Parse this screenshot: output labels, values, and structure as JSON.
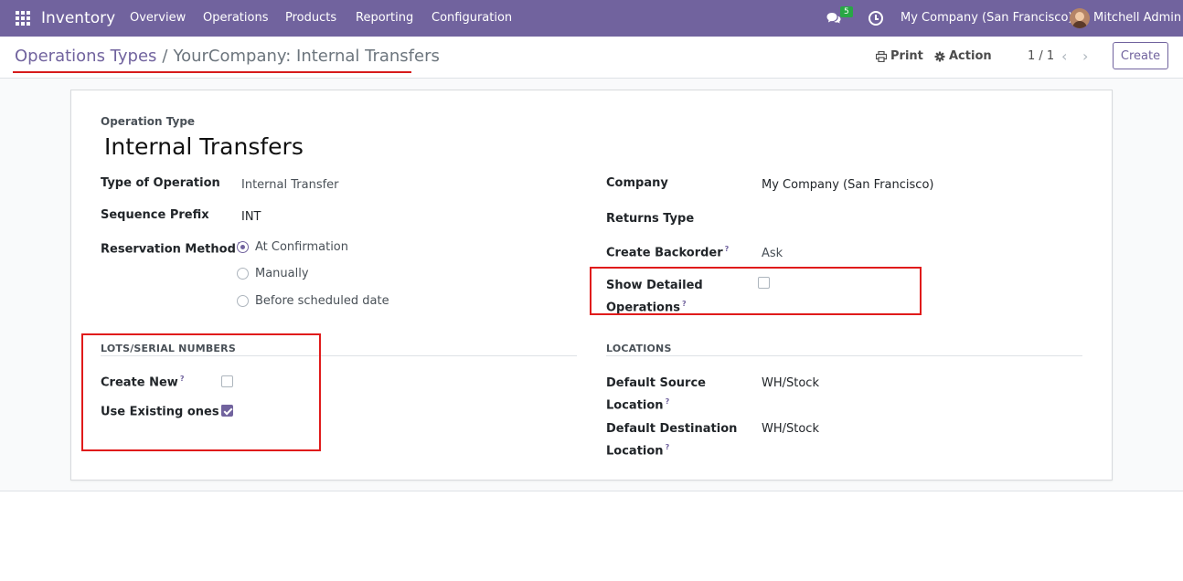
{
  "navbar": {
    "brand": "Inventory",
    "menu": [
      "Overview",
      "Operations",
      "Products",
      "Reporting",
      "Configuration"
    ],
    "chat_count": "5",
    "company": "My Company (San Francisco)",
    "user": "Mitchell Admin"
  },
  "control_panel": {
    "breadcrumb_parent": "Operations Types",
    "breadcrumb_separator": "/",
    "breadcrumb_current": "YourCompany: Internal Transfers",
    "print_label": "Print",
    "action_label": "Action",
    "pager": "1 / 1",
    "create_label": "Create"
  },
  "form": {
    "operation_type_label": "Operation Type",
    "name": "Internal Transfers",
    "left": {
      "type_of_operation_label": "Type of Operation",
      "type_of_operation_value": "Internal Transfer",
      "sequence_prefix_label": "Sequence Prefix",
      "sequence_prefix_value": "INT",
      "reservation_method_label": "Reservation Method",
      "reservation_options": [
        "At Confirmation",
        "Manually",
        "Before scheduled date"
      ],
      "reservation_selected": "At Confirmation"
    },
    "right": {
      "company_label": "Company",
      "company_value": "My Company (San Francisco)",
      "returns_type_label": "Returns Type",
      "returns_type_value": "",
      "create_backorder_label": "Create Backorder",
      "create_backorder_value": "Ask",
      "show_detailed_label_1": "Show Detailed",
      "show_detailed_label_2": "Operations",
      "show_detailed_checked": false
    },
    "lots": {
      "title": "LOTS/SERIAL NUMBERS",
      "create_new_label": "Create New",
      "create_new_checked": false,
      "use_existing_label": "Use Existing ones",
      "use_existing_checked": true
    },
    "locations": {
      "title": "LOCATIONS",
      "default_source_label_1": "Default Source",
      "default_source_label_2": "Location",
      "default_source_value": "WH/Stock",
      "default_dest_label_1": "Default Destination",
      "default_dest_label_2": "Location",
      "default_dest_value": "WH/Stock"
    },
    "tooltip_marker": "?"
  },
  "colors": {
    "brand": "#71639e",
    "highlight": "#e01b1b",
    "badge": "#28a745"
  }
}
